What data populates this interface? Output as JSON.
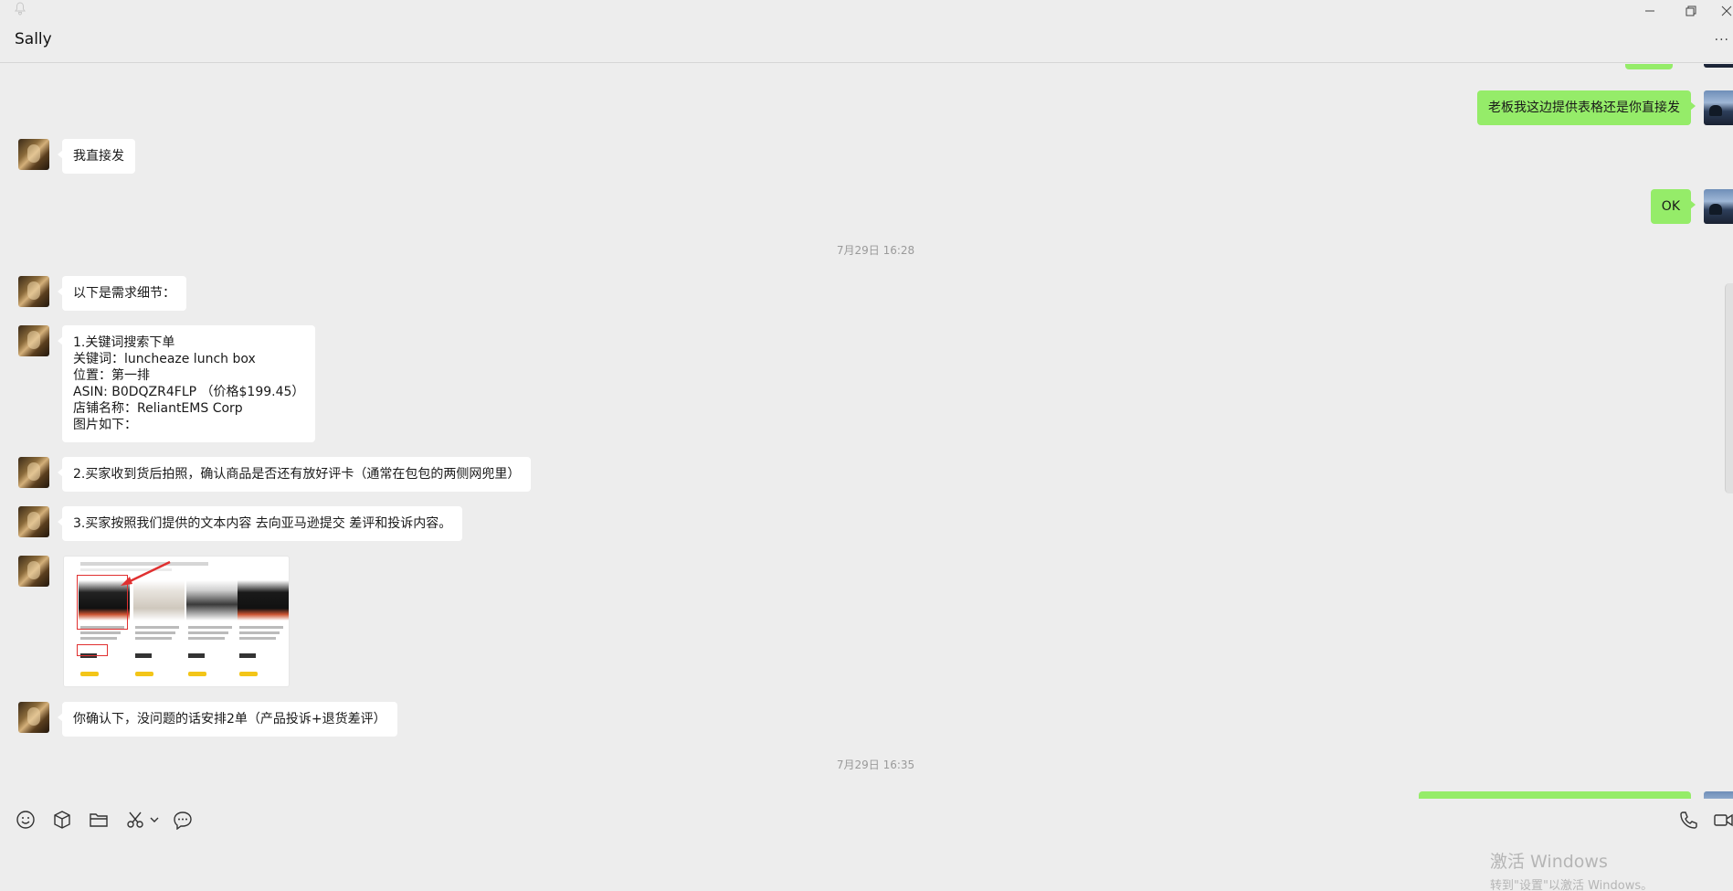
{
  "window": {
    "chat_title": "Sally",
    "more_label": "···"
  },
  "messages": {
    "m1": "老板我这边提供表格还是你直接发",
    "m2": "我直接发",
    "m3": "OK",
    "ts1": "7月29日 16:28",
    "m4": "以下是需求细节：",
    "m5": "1.关键词搜索下单\n关键词：luncheaze lunch box\n位置：第一排\nASIN: B0DQZR4FLP （价格$199.45）\n店铺名称：ReliantEMS Corp\n图片如下：",
    "m6": "2.买家收到货后拍照，确认商品是否还有放好评卡（通常在包包的两侧网兜里）",
    "m7": "3.买家按照我们提供的文本内容 去向亚马逊提交 差评和投诉内容。",
    "m8": "你确认下，没问题的话安排2单（产品投诉+退货差评）",
    "ts2": "7月29日 16:35"
  },
  "toolbar": {
    "icons": [
      "emoji-icon",
      "box-icon",
      "folder-icon",
      "scissors-icon",
      "chat-history-icon",
      "phone-icon",
      "video-icon"
    ]
  },
  "activation": {
    "line1": "激活 Windows",
    "line2": "转到\"设置\"以激活 Windows。"
  },
  "colors": {
    "background": "#ededed",
    "outgoing_bubble": "#95ec69",
    "incoming_bubble": "#ffffff",
    "timestamp": "#9a9a9a"
  }
}
